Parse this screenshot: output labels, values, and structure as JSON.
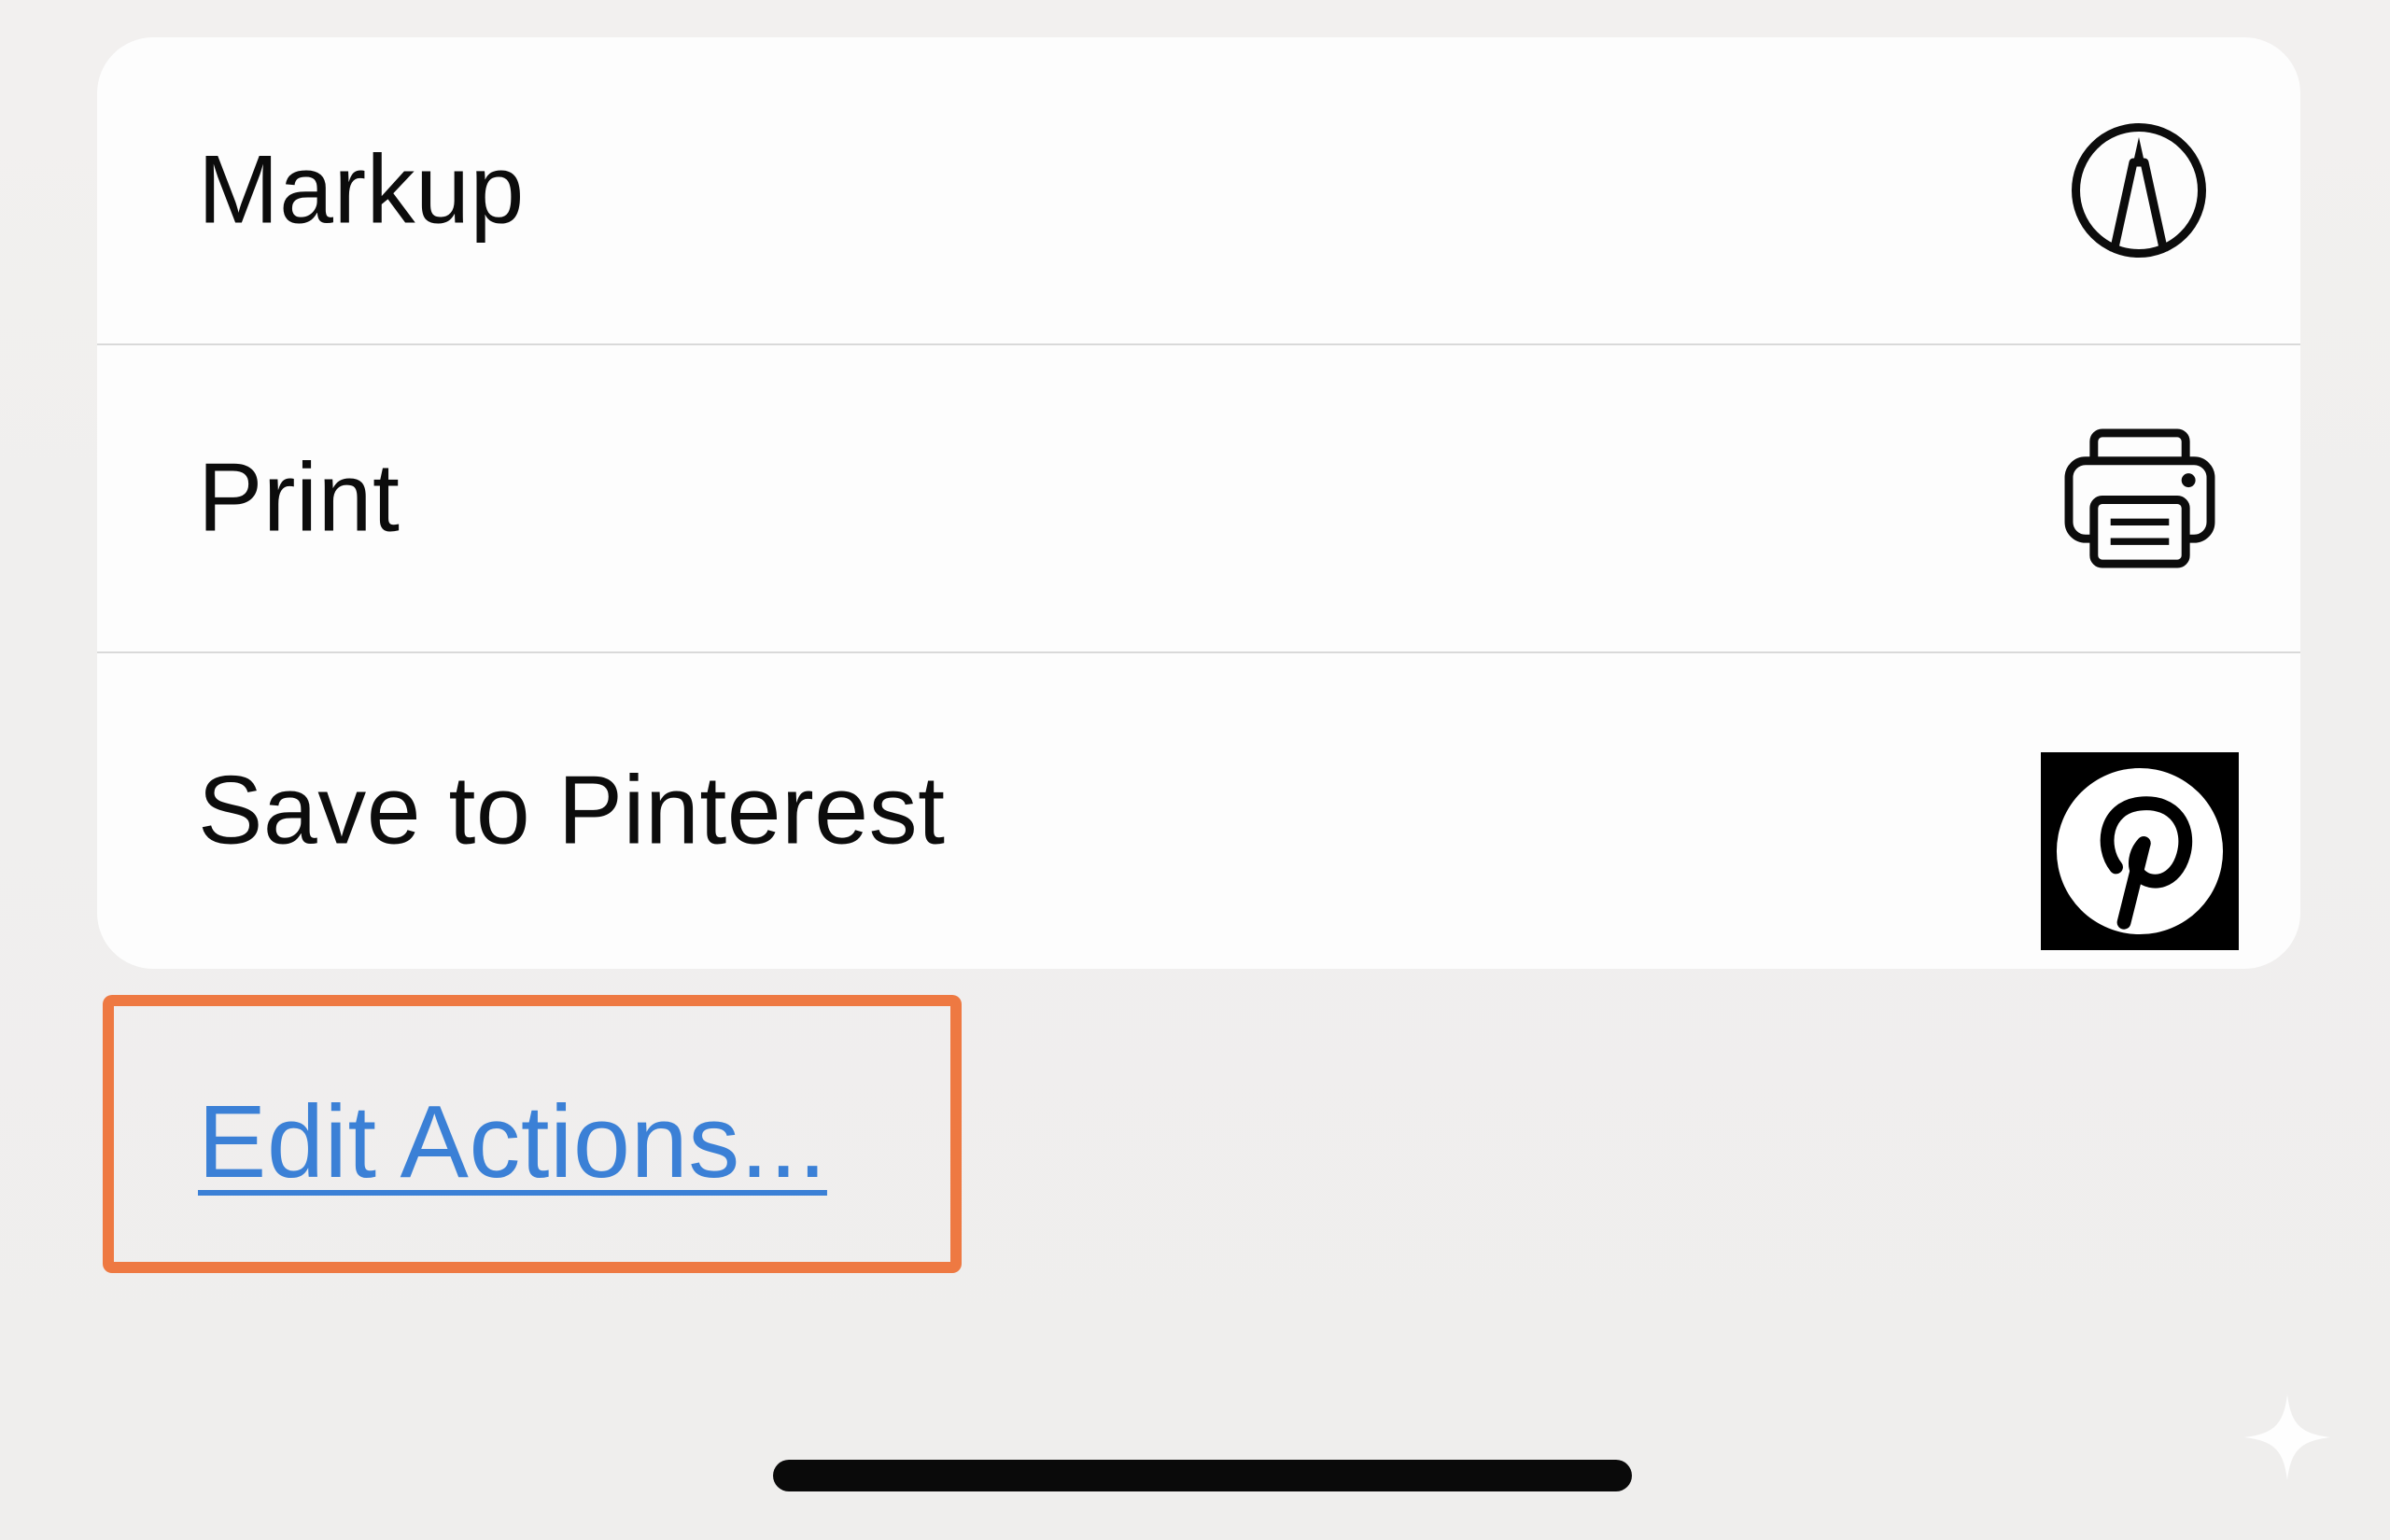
{
  "actions": {
    "items": [
      {
        "label": "Markup",
        "icon": "markup-icon"
      },
      {
        "label": "Print",
        "icon": "printer-icon"
      },
      {
        "label": "Save to Pinterest",
        "icon": "pinterest-icon"
      }
    ]
  },
  "edit_actions": {
    "label": "Edit Actions...",
    "highlight_color": "#ee7942",
    "link_color": "#3b80d6"
  },
  "home_indicator": {
    "icon": "home-indicator-bar"
  },
  "watermark": {
    "icon": "sparkle-icon"
  }
}
